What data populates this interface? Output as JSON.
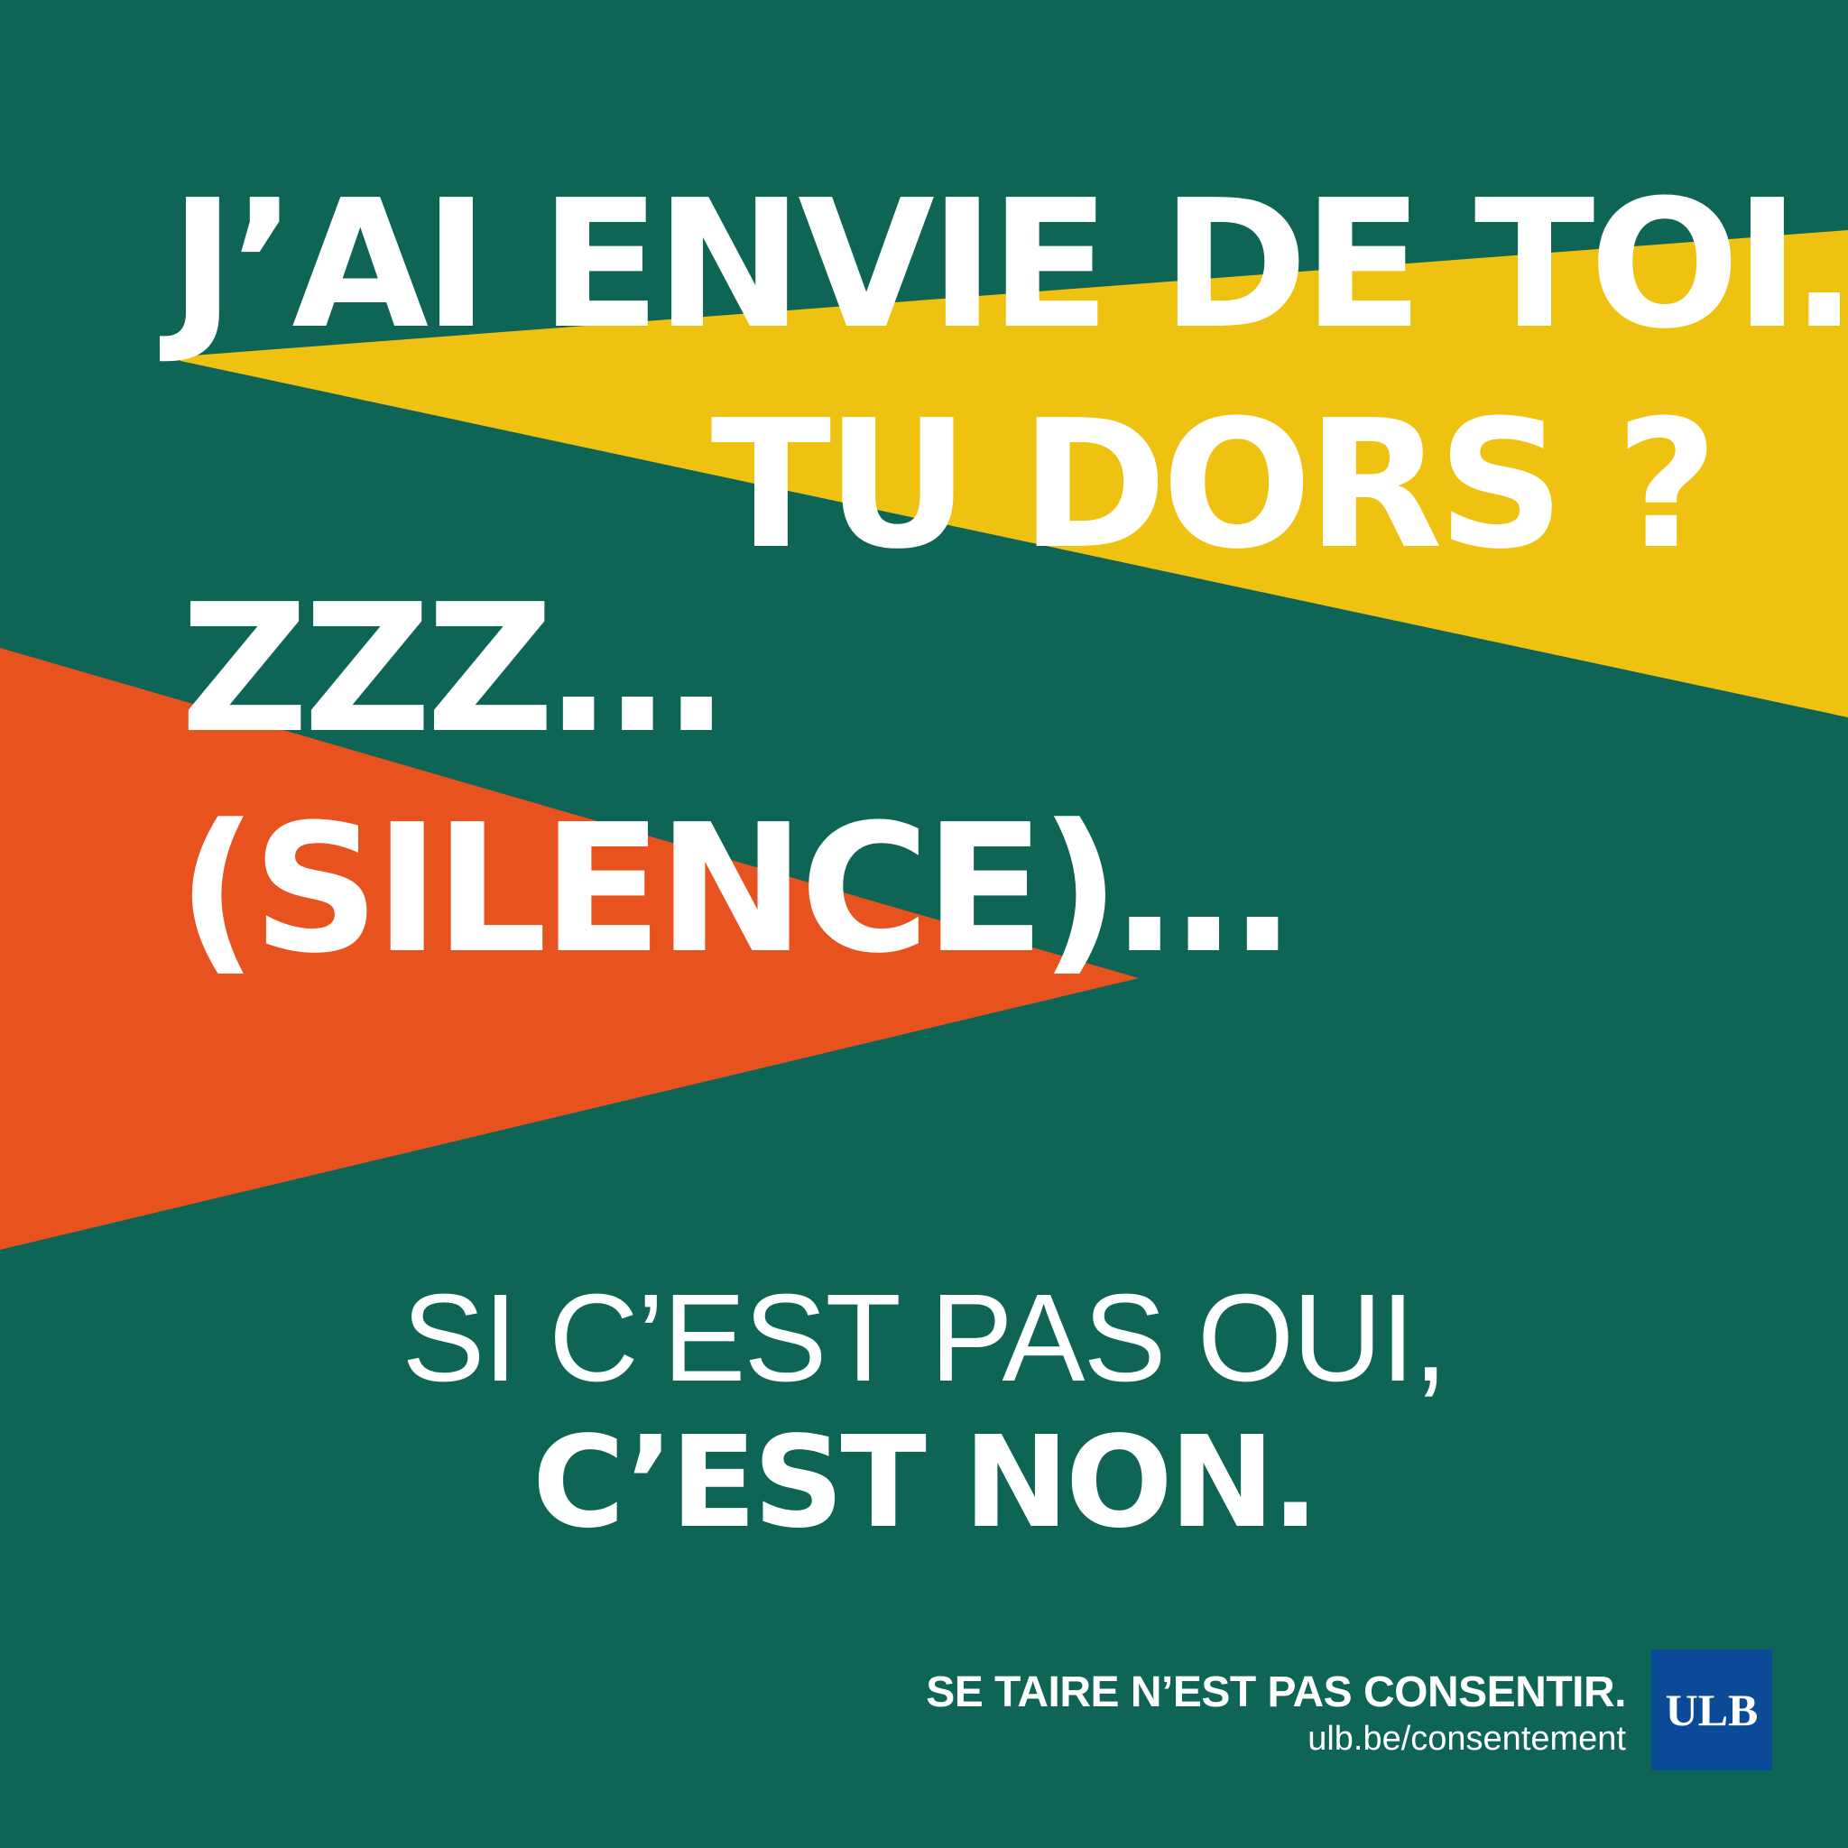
{
  "colors": {
    "background": "#0e6556",
    "band_yellow": "#efc211",
    "band_orange": "#e7521e",
    "text": "#ffffff",
    "logo_bg": "#0a4a96"
  },
  "headline": {
    "line1": "J’AI ENVIE DE TOI…",
    "line2": "TU DORS ?",
    "line3": "ZZZ…",
    "line4": "(SILENCE)…"
  },
  "tagline": {
    "light": "SI C’EST PAS OUI,",
    "bold": "C’EST NON."
  },
  "footer": {
    "slogan": "SE TAIRE N’EST PAS CONSENTIR.",
    "url": "ulb.be/consentement",
    "logo": "ULB"
  }
}
